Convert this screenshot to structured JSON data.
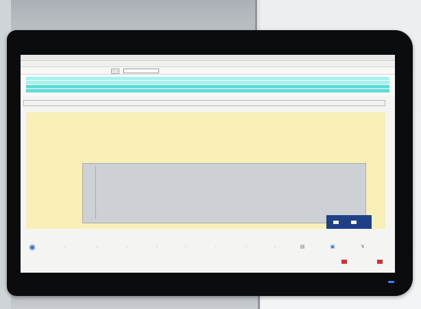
{
  "scene": "monitor-displaying-desktop-application",
  "colors": {
    "monitor_bezel": "#0b0c0e",
    "highlight_row": "#5fdcd6",
    "selected_row": "#a7f1ee",
    "panel_yellow": "#f8efb6",
    "dialog_gray": "#cdd1d5",
    "logo_blue": "#1f3f86",
    "power_led": "#2e8cff",
    "alert_red": "#d23232"
  },
  "icons": {
    "globe": "globe-icon",
    "arrow": "arrow-icon",
    "doc": "document-icon",
    "copy": "copy-icon"
  }
}
